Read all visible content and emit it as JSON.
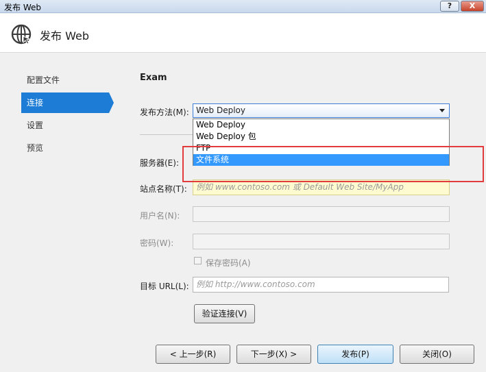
{
  "window": {
    "title": "发布 Web",
    "help_label": "?",
    "close_label": "X"
  },
  "header": {
    "title": "发布 Web",
    "icon": "globe-icon"
  },
  "sidebar": {
    "items": [
      {
        "label": "配置文件",
        "active": false
      },
      {
        "label": "连接",
        "active": true
      },
      {
        "label": "设置",
        "active": false
      },
      {
        "label": "预览",
        "active": false
      }
    ]
  },
  "main": {
    "profile_name": "Exam",
    "publish_method": {
      "label": "发布方法(M):",
      "value": "Web Deploy",
      "options": [
        "Web Deploy",
        "Web Deploy 包",
        "FTP",
        "文件系统"
      ],
      "highlighted_option": "文件系统"
    },
    "server": {
      "label": "服务器(E):"
    },
    "site_name": {
      "label": "站点名称(T):",
      "placeholder": "例如 www.contoso.com 或 Default Web Site/MyApp"
    },
    "username": {
      "label": "用户名(N):"
    },
    "password": {
      "label": "密码(W):"
    },
    "save_password": {
      "label": "保存密码(A)",
      "checked": false
    },
    "target_url": {
      "label": "目标 URL(L):",
      "placeholder": "例如 http://www.contoso.com"
    },
    "validate_button": "验证连接(V)"
  },
  "footer": {
    "prev": "< 上一步(R)",
    "next": "下一步(X) >",
    "publish": "发布(P)",
    "close": "关闭(O)"
  },
  "colors": {
    "accent": "#1c7cd6",
    "selection": "#3399ff",
    "annotation": "#e23b3b"
  }
}
